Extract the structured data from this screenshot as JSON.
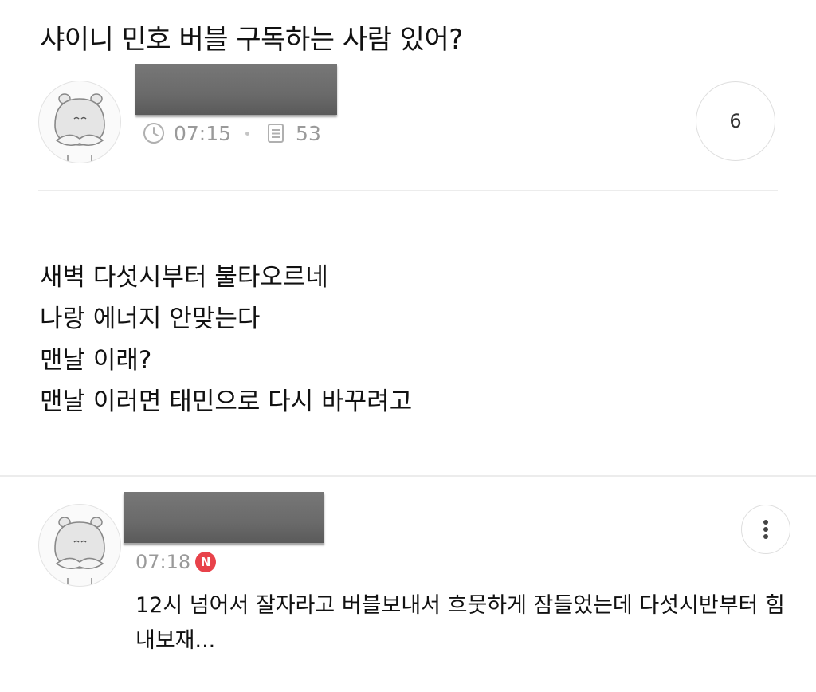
{
  "post": {
    "title": "샤이니 민호 버블 구독하는 사람 있어?",
    "time": "07:15",
    "views": "53",
    "comment_count": "6",
    "body_lines": [
      "새벽 다섯시부터 불타오르네",
      "나랑 에너지 안맞는다",
      "맨날 이래?",
      "맨날 이러면 태민으로 다시 바꾸려고"
    ]
  },
  "comment": {
    "time": "07:18",
    "badge": "N",
    "text": "12시 넘어서 잘자라고 버블보내서 흐뭇하게 잠들었는데 다섯시반부터 힘내보재..."
  },
  "icons": {
    "avatar": "hamster-avatar-icon",
    "time": "clock-icon",
    "views": "document-icon",
    "more": "kebab-menu-icon"
  },
  "colors": {
    "new_badge": "#e8424a",
    "meta_text": "#9a9a9a",
    "redaction": "#6a6a6a"
  }
}
